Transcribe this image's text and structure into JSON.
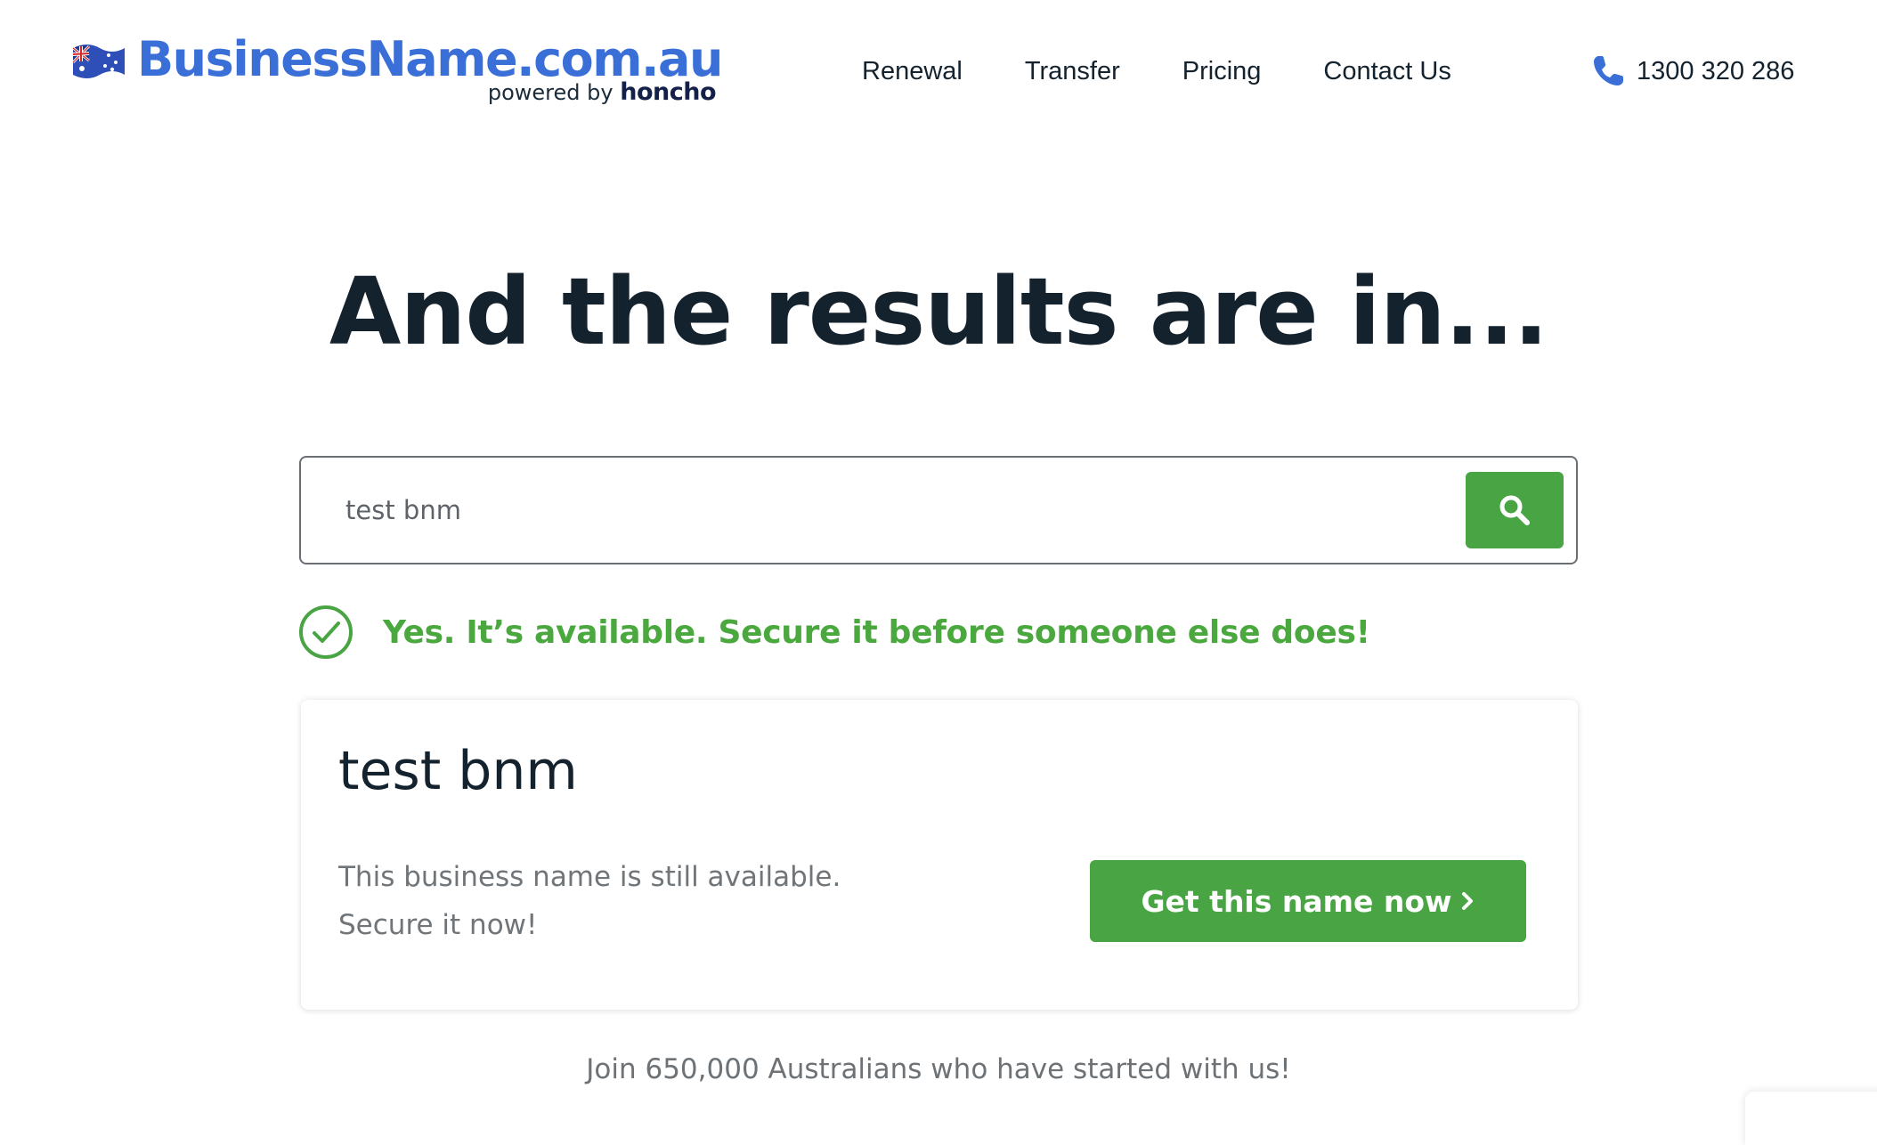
{
  "header": {
    "logo_text": "BusinessName.com.au",
    "logo_powered_prefix": "powered by",
    "logo_powered_brand": "honcho",
    "nav": [
      {
        "label": "Renewal"
      },
      {
        "label": "Transfer"
      },
      {
        "label": "Pricing"
      },
      {
        "label": "Contact Us"
      }
    ],
    "phone": "1300 320 286"
  },
  "hero": {
    "title": "And the results are in..."
  },
  "search": {
    "value": "test bnm",
    "button_icon": "search-icon"
  },
  "status": {
    "icon": "check-circle-icon",
    "message": "Yes. It’s available. Secure it before someone else does!"
  },
  "result": {
    "name": "test bnm",
    "description_line1": "This business name is still available.",
    "description_line2": "Secure it now!",
    "button_label": "Get this name now"
  },
  "footer": {
    "tagline": "Join 650,000 Australians who have started with us!"
  },
  "colors": {
    "brand_blue": "#3a6fd8",
    "accent_green": "#49a444",
    "text_dark": "#14222e",
    "text_muted": "#707579"
  }
}
